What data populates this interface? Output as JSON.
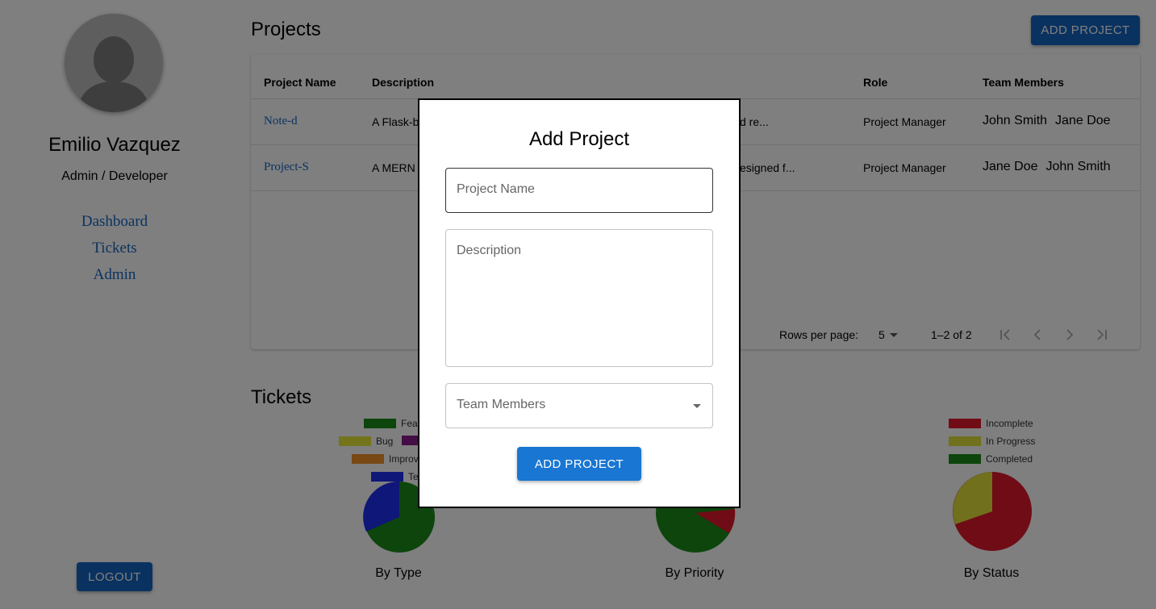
{
  "user": {
    "name": "Emilio Vazquez",
    "role": "Admin / Developer"
  },
  "nav": {
    "items": [
      {
        "label": "Dashboard"
      },
      {
        "label": "Tickets"
      },
      {
        "label": "Admin"
      }
    ]
  },
  "logout_label": "LOGOUT",
  "projects": {
    "title": "Projects",
    "add_label": "ADD PROJECT",
    "columns": [
      "Project Name",
      "Description",
      "Role",
      "Team Members"
    ],
    "rows": [
      {
        "name": "Note-d",
        "description_start": "A Flask-b",
        "description_end": "d re...",
        "role": "Project Manager",
        "members": [
          "John Smith",
          "Jane Doe"
        ]
      },
      {
        "name": "Project-S",
        "description_start": "A MERN",
        "description_end": "esigned f...",
        "role": "Project Manager",
        "members": [
          "Jane Doe",
          "John Smith"
        ]
      }
    ],
    "pagination": {
      "rows_per_page_label": "Rows per page:",
      "rows_per_page_value": "5",
      "range": "1–2 of 2"
    }
  },
  "tickets": {
    "title": "Tickets",
    "charts": [
      {
        "label": "By Type",
        "legend": [
          {
            "name": "Fea",
            "color": "#1b8a1b"
          },
          {
            "name": "Bug",
            "color": "#e8e83a"
          },
          {
            "name": "",
            "color": "#8a1b8a"
          },
          {
            "name": "Improv",
            "color": "#f0922b"
          },
          {
            "name": "Te",
            "color": "#1f2ff0"
          }
        ]
      },
      {
        "label": "By Priority"
      },
      {
        "label": "By Status",
        "legend": [
          {
            "name": "Incomplete",
            "color": "#e0182c"
          },
          {
            "name": "In Progress",
            "color": "#e0e03a"
          },
          {
            "name": "Completed",
            "color": "#1b8a1b"
          }
        ]
      }
    ]
  },
  "modal": {
    "title": "Add Project",
    "project_name_placeholder": "Project Name",
    "description_placeholder": "Description",
    "team_members_placeholder": "Team Members",
    "submit_label": "ADD PROJECT"
  }
}
